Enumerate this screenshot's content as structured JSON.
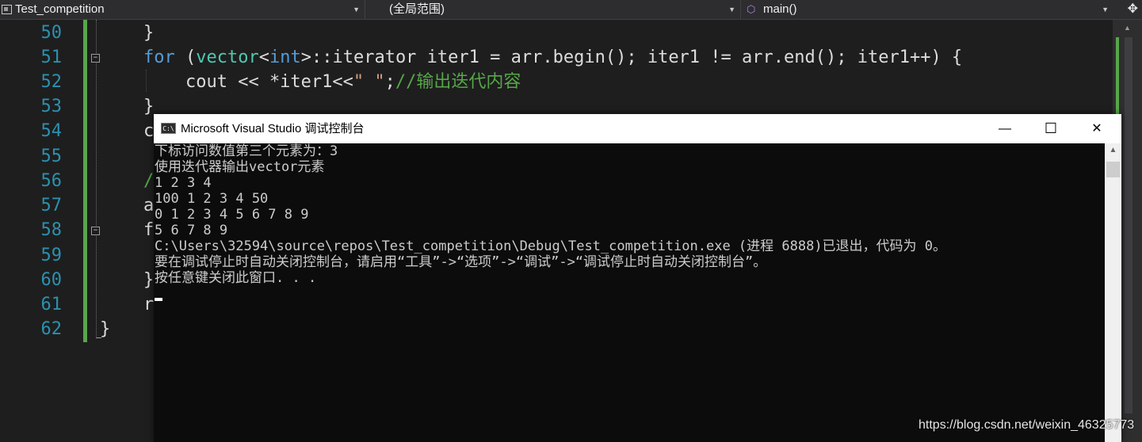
{
  "navbar": {
    "project": "Test_competition",
    "scope": "(全局范围)",
    "function": "main()",
    "project_icon": "cpp-project-icon",
    "function_icon": "function-cube-icon",
    "split_icon": "split-window-icon"
  },
  "editor": {
    "line_numbers": [
      "50",
      "51",
      "52",
      "53",
      "54",
      "55",
      "56",
      "57",
      "58",
      "59",
      "60",
      "61",
      "62"
    ],
    "lines": [
      {
        "indent": "}"
      },
      {
        "for_kw": "for",
        "p1": " (",
        "vector": "vector",
        "lt": "<",
        "int": "int",
        "rest": ">::iterator iter1 = arr.begin(); iter1 != arr.end(); iter1++) {"
      },
      {
        "text": "    cout << *iter1<<",
        "str": "\" \"",
        "semi": ";",
        "comment": "//输出迭代内容"
      },
      {
        "text": "}"
      },
      {
        "text": "c"
      },
      {
        "text": "/"
      },
      {
        "text": "a"
      },
      {
        "text": "f"
      },
      {
        "text": "}"
      },
      {
        "text": "r"
      },
      {
        "text": "}"
      }
    ],
    "accent_color": "#57a64a"
  },
  "console": {
    "title": "Microsoft Visual Studio 调试控制台",
    "icon_label": "C:\\",
    "minimize": "—",
    "maximize": "☐",
    "close": "✕",
    "output": [
      "下标访问数值第三个元素为：3",
      "使用迭代器输出vector元素",
      "1 2 3 4",
      "100 1 2 3 4 50",
      "0 1 2 3 4 5 6 7 8 9",
      "5 6 7 8 9",
      "C:\\Users\\32594\\source\\repos\\Test_competition\\Debug\\Test_competition.exe (进程 6888)已退出，代码为 0。",
      "要在调试停止时自动关闭控制台，请启用“工具”->“选项”->“调试”->“调试停止时自动关闭控制台”。",
      "按任意键关闭此窗口. . ."
    ]
  },
  "watermark": "https://blog.csdn.net/weixin_46325773"
}
